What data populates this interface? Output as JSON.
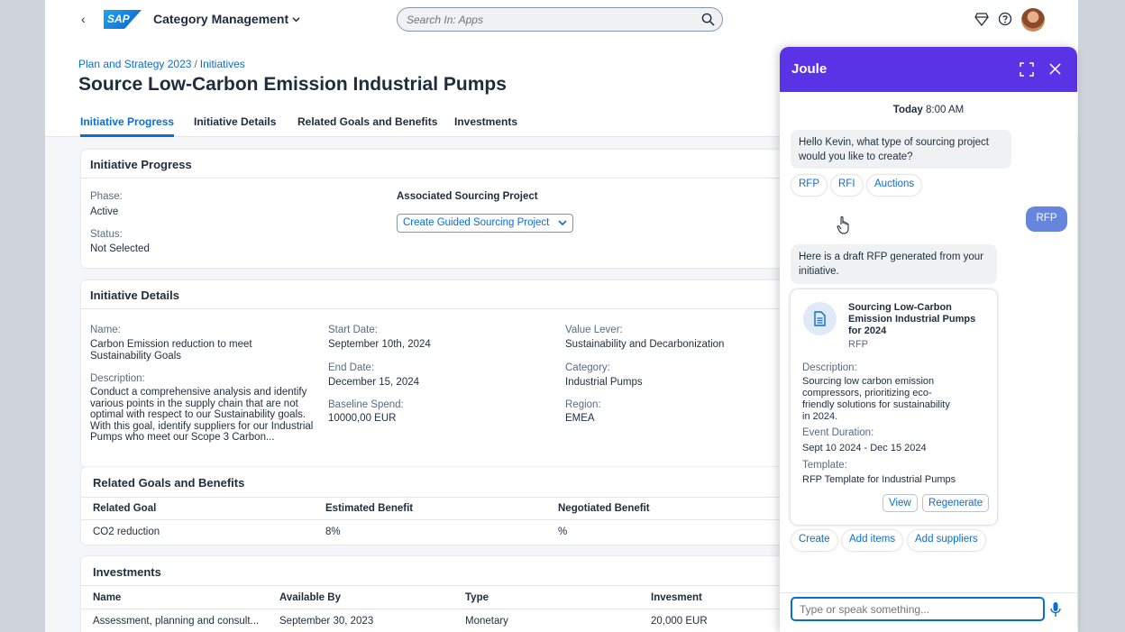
{
  "shell": {
    "app_title": "Category Management",
    "search_placeholder": "Search In: Apps",
    "logo_text": "SAP"
  },
  "header": {
    "breadcrumbs": [
      "Plan and Strategy 2023",
      "Initiatives"
    ],
    "separator": "/",
    "title": "Source Low-Carbon Emission Industrial Pumps",
    "tabs": [
      "Initiative Progress",
      "Initiative Details",
      "Related Goals and Benefits",
      "Investments"
    ],
    "active_tab": "Initiative Progress"
  },
  "progress": {
    "title": "Initiative Progress",
    "phase_label": "Phase:",
    "phase_value": "Active",
    "status_label": "Status:",
    "status_value": "Not Selected",
    "assoc_label": "Associated Sourcing Project",
    "assoc_dropdown": "Create Guided Sourcing Project"
  },
  "details": {
    "title": "Initiative Details",
    "name_label": "Name:",
    "name_value": "Carbon Emission reduction to meet Sustainability Goals",
    "description_label": "Description:",
    "description_value": "Conduct a comprehensive analysis and identify various points in the supply chain that are not optimal with respect to our Sustainability goals. With this goal, identify suppliers for our Industrial Pumps who meet our Scope 3 Carbon...",
    "start_label": "Start Date:",
    "start_value": "September 10th, 2024",
    "end_label": "End Date:",
    "end_value": "December 15, 2024",
    "baseline_label": "Baseline Spend:",
    "baseline_value": "10000,00 EUR",
    "lever_label": "Value Lever:",
    "lever_value": "Sustainability and Decarbonization",
    "category_label": "Category:",
    "category_value": "Industrial Pumps",
    "region_label": "Region:",
    "region_value": "EMEA"
  },
  "goals": {
    "title": "Related Goals and Benefits",
    "columns": [
      "Related Goal",
      "Estimated Benefit",
      "Negotiated Benefit"
    ],
    "rows": [
      [
        "CO2 reduction",
        "8%",
        "%"
      ]
    ]
  },
  "investments": {
    "title": "Investments",
    "columns": [
      "Name",
      "Available By",
      "Type",
      "Invesment"
    ],
    "rows": [
      [
        "Assessment, planning and consult...",
        "September 30, 2023",
        "Monetary",
        "20,000 EUR"
      ]
    ]
  },
  "joule": {
    "title": "Joule",
    "time_day": "Today",
    "time_value": "8:00 AM",
    "greeting": "Hello Kevin, what type of sourcing project would you like to create?",
    "options": [
      "RFP",
      "RFI",
      "Auctions"
    ],
    "user_reply": "RFP",
    "draft_message": "Here is a draft RFP generated from your initiative.",
    "card": {
      "title": "Sourcing Low-Carbon Emission Industrial Pumps for 2024",
      "subtitle": "RFP",
      "description_label": "Description:",
      "description_value": "Sourcing low carbon emission compressors, prioritizing eco-friendly solutions for sustainability in 2024.",
      "duration_label": "Event Duration:",
      "duration_value": "Sept 10 2024 - Dec 15 2024",
      "template_label": "Template:",
      "template_value": "RFP Template for Industrial Pumps",
      "view_label": "View",
      "regenerate_label": "Regenerate"
    },
    "actions": [
      "Create",
      "Add items",
      "Add suppliers"
    ],
    "input_placeholder": "Type or speak something..."
  },
  "colors": {
    "accent": "#0a6ed1",
    "joule_header": "#5b33e6",
    "user_bubble": "#6685dc"
  }
}
